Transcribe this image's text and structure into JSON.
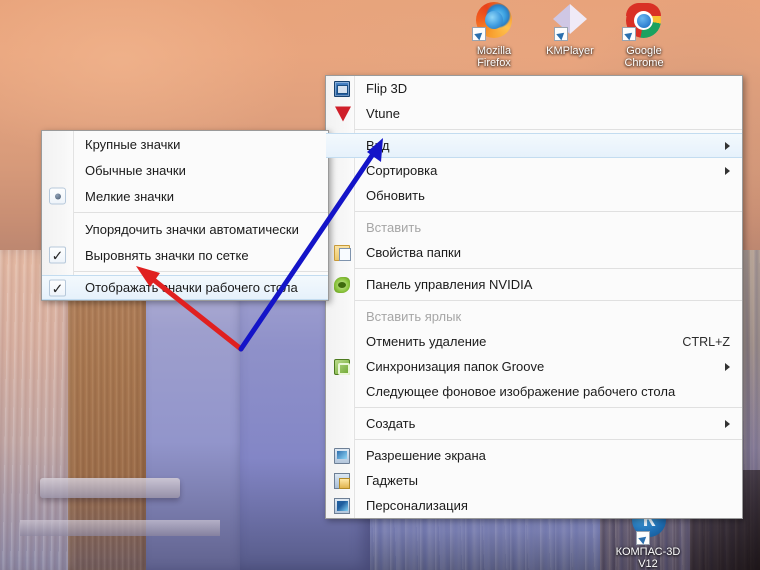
{
  "desktop": {
    "icons": [
      {
        "name": "mozilla-firefox",
        "line1": "Mozilla",
        "line2": "Firefox"
      },
      {
        "name": "kmplayer",
        "line1": "KMPlayer",
        "line2": ""
      },
      {
        "name": "google-chrome",
        "line1": "Google",
        "line2": "Chrome"
      },
      {
        "name": "kompas-3d",
        "line1": "КОМПАС-3D",
        "line2": "V12"
      }
    ]
  },
  "context_menu": {
    "items": [
      {
        "label": "Flip 3D",
        "icon": "flip3d-icon",
        "type": "item"
      },
      {
        "label": "Vtune",
        "icon": "vtune-icon",
        "type": "item"
      },
      {
        "type": "separator"
      },
      {
        "label": "Вид",
        "icon": "",
        "type": "submenu",
        "highlighted": true
      },
      {
        "label": "Сортировка",
        "icon": "",
        "type": "submenu"
      },
      {
        "label": "Обновить",
        "icon": "",
        "type": "item"
      },
      {
        "type": "separator"
      },
      {
        "label": "Вставить",
        "icon": "",
        "type": "item",
        "disabled": true
      },
      {
        "label": "Свойства папки",
        "icon": "folder-properties-icon",
        "type": "item"
      },
      {
        "type": "separator"
      },
      {
        "label": "Панель управления NVIDIA",
        "icon": "nvidia-icon",
        "type": "item"
      },
      {
        "type": "separator"
      },
      {
        "label": "Вставить ярлык",
        "icon": "",
        "type": "item",
        "disabled": true
      },
      {
        "label": "Отменить удаление",
        "icon": "",
        "type": "item",
        "accel": "CTRL+Z"
      },
      {
        "label": "Синхронизация папок Groove",
        "icon": "groove-icon",
        "type": "submenu"
      },
      {
        "label": "Следующее фоновое изображение рабочего стола",
        "icon": "",
        "type": "item"
      },
      {
        "type": "separator"
      },
      {
        "label": "Создать",
        "icon": "",
        "type": "submenu"
      },
      {
        "type": "separator"
      },
      {
        "label": "Разрешение экрана",
        "icon": "screen-resolution-icon",
        "type": "item"
      },
      {
        "label": "Гаджеты",
        "icon": "gadgets-icon",
        "type": "item"
      },
      {
        "label": "Персонализация",
        "icon": "personalization-icon",
        "type": "item"
      }
    ]
  },
  "view_submenu": {
    "items": [
      {
        "label": "Крупные значки",
        "mark": "none"
      },
      {
        "label": "Обычные значки",
        "mark": "none"
      },
      {
        "label": "Мелкие значки",
        "mark": "radio"
      },
      {
        "type": "separator"
      },
      {
        "label": "Упорядочить значки автоматически",
        "mark": "none"
      },
      {
        "label": "Выровнять значки по сетке",
        "mark": "check"
      },
      {
        "type": "separator"
      },
      {
        "label": "Отображать значки рабочего стола",
        "mark": "check",
        "highlighted": true
      }
    ]
  },
  "annotations": {
    "arrow_red": {
      "color": "#e02020",
      "points": "from (240,348) to (139,268)"
    },
    "arrow_blue": {
      "color": "#1414c8",
      "points": "from (240,348) to (382,139)"
    }
  }
}
